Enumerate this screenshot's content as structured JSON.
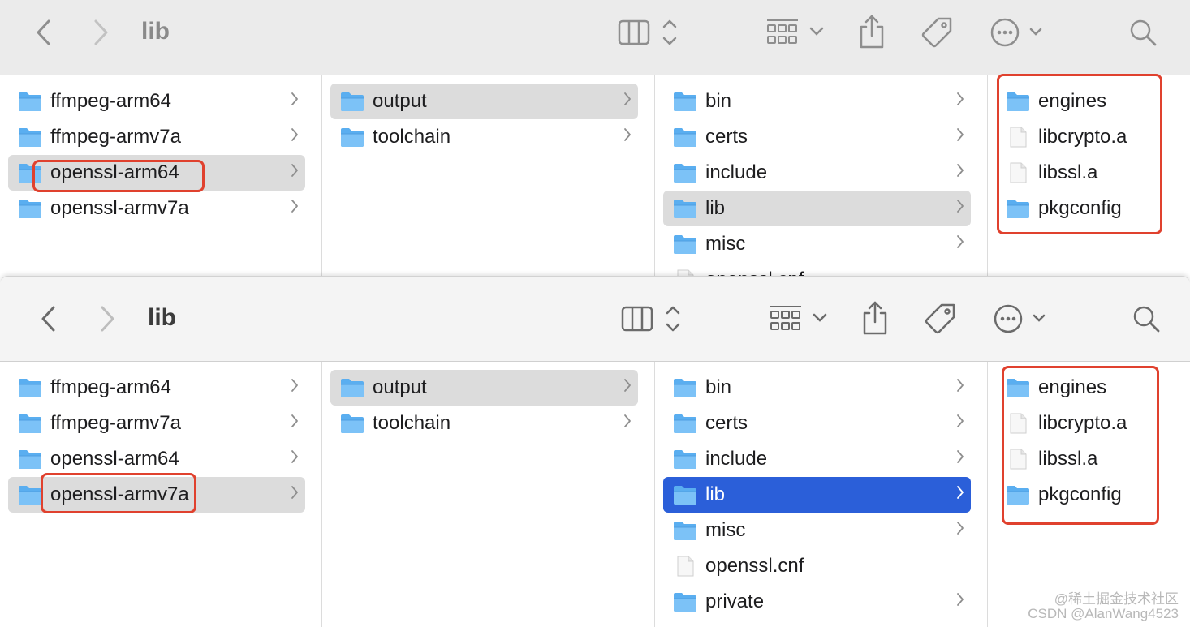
{
  "window_top": {
    "title": "lib",
    "columns": [
      {
        "items": [
          {
            "label": "ffmpeg-arm64",
            "kind": "folder",
            "chevron": true
          },
          {
            "label": "ffmpeg-armv7a",
            "kind": "folder",
            "chevron": true
          },
          {
            "label": "openssl-arm64",
            "kind": "folder",
            "chevron": true,
            "selected": "gray",
            "highlight": true
          },
          {
            "label": "openssl-armv7a",
            "kind": "folder",
            "chevron": true
          }
        ]
      },
      {
        "items": [
          {
            "label": "output",
            "kind": "folder",
            "chevron": true,
            "selected": "gray"
          },
          {
            "label": "toolchain",
            "kind": "folder",
            "chevron": true
          }
        ]
      },
      {
        "items": [
          {
            "label": "bin",
            "kind": "folder",
            "chevron": true
          },
          {
            "label": "certs",
            "kind": "folder",
            "chevron": true
          },
          {
            "label": "include",
            "kind": "folder",
            "chevron": true
          },
          {
            "label": "lib",
            "kind": "folder",
            "chevron": true,
            "selected": "gray"
          },
          {
            "label": "misc",
            "kind": "folder",
            "chevron": true
          },
          {
            "label": "openssl.cnf",
            "kind": "file",
            "chevron": false
          }
        ]
      },
      {
        "items": [
          {
            "label": "engines",
            "kind": "folder",
            "chevron": false
          },
          {
            "label": "libcrypto.a",
            "kind": "file",
            "chevron": false
          },
          {
            "label": "libssl.a",
            "kind": "file",
            "chevron": false
          },
          {
            "label": "pkgconfig",
            "kind": "folder",
            "chevron": false
          }
        ]
      }
    ]
  },
  "window_bottom": {
    "title": "lib",
    "columns": [
      {
        "items": [
          {
            "label": "ffmpeg-arm64",
            "kind": "folder",
            "chevron": true
          },
          {
            "label": "ffmpeg-armv7a",
            "kind": "folder",
            "chevron": true
          },
          {
            "label": "openssl-arm64",
            "kind": "folder",
            "chevron": true
          },
          {
            "label": "openssl-armv7a",
            "kind": "folder",
            "chevron": true,
            "selected": "gray",
            "highlight": true
          }
        ]
      },
      {
        "items": [
          {
            "label": "output",
            "kind": "folder",
            "chevron": true,
            "selected": "gray"
          },
          {
            "label": "toolchain",
            "kind": "folder",
            "chevron": true
          }
        ]
      },
      {
        "items": [
          {
            "label": "bin",
            "kind": "folder",
            "chevron": true
          },
          {
            "label": "certs",
            "kind": "folder",
            "chevron": true
          },
          {
            "label": "include",
            "kind": "folder",
            "chevron": true
          },
          {
            "label": "lib",
            "kind": "folder",
            "chevron": true,
            "selected": "blue"
          },
          {
            "label": "misc",
            "kind": "folder",
            "chevron": true
          },
          {
            "label": "openssl.cnf",
            "kind": "file",
            "chevron": false
          },
          {
            "label": "private",
            "kind": "folder",
            "chevron": true
          }
        ]
      },
      {
        "items": [
          {
            "label": "engines",
            "kind": "folder",
            "chevron": false
          },
          {
            "label": "libcrypto.a",
            "kind": "file",
            "chevron": false
          },
          {
            "label": "libssl.a",
            "kind": "file",
            "chevron": false
          },
          {
            "label": "pkgconfig",
            "kind": "folder",
            "chevron": false
          }
        ]
      }
    ]
  },
  "icons": {
    "back": "chevron-left-icon",
    "forward": "chevron-right-icon",
    "view": "column-view-icon",
    "group": "grid-icon",
    "share": "share-icon",
    "tag": "tag-icon",
    "more": "ellipsis-circle-icon",
    "search": "search-icon"
  },
  "colors": {
    "accent_blue": "#2b5fd9",
    "highlight_red": "#e0412e",
    "folder_blue": "#5aaef0"
  },
  "watermark": {
    "line1": "@稀土掘金技术社区",
    "line2": "CSDN @AlanWang4523"
  }
}
